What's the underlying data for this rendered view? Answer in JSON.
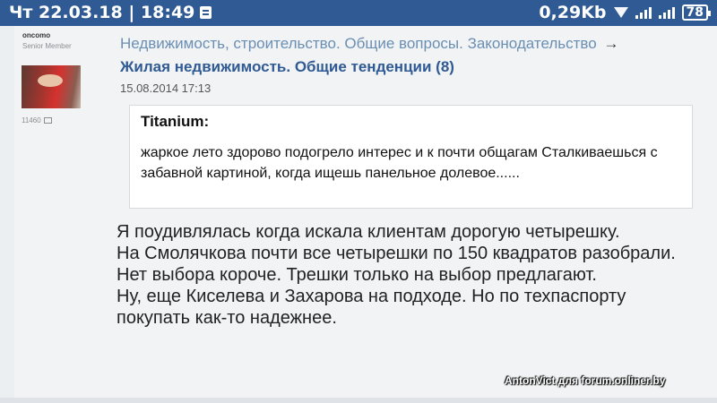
{
  "status_bar": {
    "datetime": "Чт 22.03.18 | 18:49",
    "speed": "0,29Kb",
    "battery": "78",
    "icons": [
      "notification-icon",
      "wifi-icon",
      "signal-icon",
      "signal-icon",
      "battery-icon"
    ]
  },
  "author": {
    "name": "oncomo",
    "rank": "Senior Member",
    "post_count": "11460"
  },
  "breadcrumb": {
    "path": "Недвижимость, строительство. Общие вопросы. Законодательство",
    "arrow": "→"
  },
  "topic": {
    "title": "Жилая недвижимость. Общие тенденции (8)"
  },
  "post": {
    "date": "15.08.2014 17:13",
    "quote": {
      "author": "Titanium:",
      "text": "жаркое лето здорово подогрело интерес и к почти общагам Сталкиваешься с забавной картиной, когда ищешь панельное долевое......"
    },
    "lines": [
      "Я поудивлялась когда искала клиентам дорогую четырешку.",
      "На Смолячкова почти все четырешки по 150 квадратов разобрали. Нет выбора короче. Трешки только на выбор предлагают.",
      "Ну, еще Киселева и Захарова на подходе. Но по техпаспорту покупать как-то надежнее."
    ]
  },
  "watermark": "AntonVict для forum.onliner.by",
  "colors": {
    "status_bar": "#2f5a93",
    "link": "#6a8fb4",
    "title": "#2f5a93"
  }
}
